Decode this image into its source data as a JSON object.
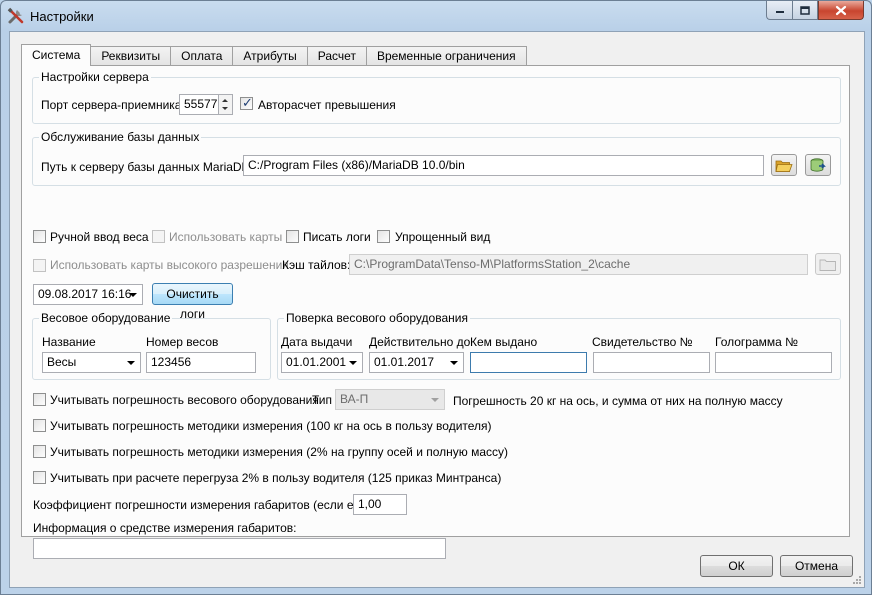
{
  "window": {
    "title": "Настройки",
    "app_icon": "tools-icon",
    "controls": [
      "minimize-icon",
      "maximize-icon",
      "close-icon"
    ]
  },
  "tabs": [
    "Система",
    "Реквизиты",
    "Оплата",
    "Атрибуты",
    "Расчет",
    "Временные ограничения"
  ],
  "active_tab": "Система",
  "server": {
    "group_title": "Настройки сервера",
    "port_label": "Порт сервера-приемника:",
    "port_value": "55577",
    "auto_calc_label": "Авторасчет превышения",
    "auto_calc_checked": true
  },
  "db": {
    "group_title": "Обслуживание базы данных",
    "path_label": "Путь к серверу базы данных MariaDb:",
    "path_value": "C:/Program Files (x86)/MariaDB 10.0/bin",
    "browse_icon": "folder-open-icon",
    "backup_icon": "database-export-icon"
  },
  "options": {
    "manual_weight": "Ручной ввод веса",
    "use_maps": "Использовать карты",
    "write_logs": "Писать логи",
    "simple_view": "Упрощенный вид",
    "hires_maps": "Использовать карты высокого разрешения",
    "tile_cache_label": "Кэш тайлов:",
    "tile_cache_value": "C:\\ProgramData\\Tenso-M\\PlatformsStation_2\\cache",
    "cache_browse_icon": "folder-icon"
  },
  "logs": {
    "date_value": "09.08.2017 16:16",
    "clear_button": "Очистить логи"
  },
  "equipment": {
    "group_title": "Весовое оборудование",
    "name_label": "Название",
    "name_value": "Весы",
    "number_label": "Номер весов",
    "number_value": "123456"
  },
  "verification": {
    "group_title": "Поверка весового оборудования",
    "issue_date_label": "Дата выдачи",
    "issue_date_value": "01.01.2001",
    "valid_until_label": "Действительно до",
    "valid_until_value": "01.01.2017",
    "issued_by_label": "Кем выдано",
    "issued_by_value": "",
    "certificate_label": "Свидетельство №",
    "certificate_value": "",
    "hologram_label": "Голограмма №",
    "hologram_value": ""
  },
  "accuracy": {
    "equipment_error_label": "Учитывать погрешность весового оборудования",
    "type_label": "Тип",
    "type_value": "ВА-П",
    "type_note": "Погрешность 20 кг на ось, и сумма от них на полную массу",
    "method_100_label": "Учитывать погрешность методики измерения (100 кг на ось в пользу водителя)",
    "method_2pct_label": "Учитывать погрешность методики измерения (2% на группу осей и полную массу)",
    "overload_label": "Учитывать при расчете перегруза 2% в пользу водителя (125 приказ Минтранса)"
  },
  "dimensions": {
    "coef_label": "Коэффициент погрешности измерения габаритов (если есть):",
    "coef_value": "1,00",
    "info_label": "Информация о средстве измерения габаритов:",
    "info_value": ""
  },
  "footer": {
    "ok": "ОК",
    "cancel": "Отмена"
  }
}
